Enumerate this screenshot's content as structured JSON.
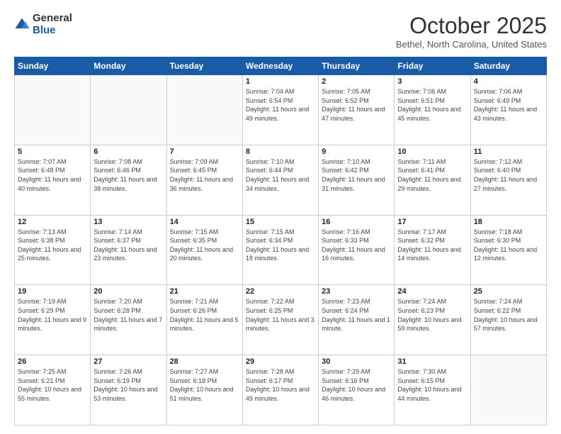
{
  "logo": {
    "general": "General",
    "blue": "Blue"
  },
  "header": {
    "month": "October 2025",
    "location": "Bethel, North Carolina, United States"
  },
  "weekdays": [
    "Sunday",
    "Monday",
    "Tuesday",
    "Wednesday",
    "Thursday",
    "Friday",
    "Saturday"
  ],
  "weeks": [
    [
      {
        "day": "",
        "info": ""
      },
      {
        "day": "",
        "info": ""
      },
      {
        "day": "",
        "info": ""
      },
      {
        "day": "1",
        "info": "Sunrise: 7:04 AM\nSunset: 6:54 PM\nDaylight: 11 hours and 49 minutes."
      },
      {
        "day": "2",
        "info": "Sunrise: 7:05 AM\nSunset: 6:52 PM\nDaylight: 11 hours and 47 minutes."
      },
      {
        "day": "3",
        "info": "Sunrise: 7:06 AM\nSunset: 6:51 PM\nDaylight: 11 hours and 45 minutes."
      },
      {
        "day": "4",
        "info": "Sunrise: 7:06 AM\nSunset: 6:49 PM\nDaylight: 11 hours and 43 minutes."
      }
    ],
    [
      {
        "day": "5",
        "info": "Sunrise: 7:07 AM\nSunset: 6:48 PM\nDaylight: 11 hours and 40 minutes."
      },
      {
        "day": "6",
        "info": "Sunrise: 7:08 AM\nSunset: 6:46 PM\nDaylight: 11 hours and 38 minutes."
      },
      {
        "day": "7",
        "info": "Sunrise: 7:09 AM\nSunset: 6:45 PM\nDaylight: 11 hours and 36 minutes."
      },
      {
        "day": "8",
        "info": "Sunrise: 7:10 AM\nSunset: 6:44 PM\nDaylight: 11 hours and 34 minutes."
      },
      {
        "day": "9",
        "info": "Sunrise: 7:10 AM\nSunset: 6:42 PM\nDaylight: 11 hours and 31 minutes."
      },
      {
        "day": "10",
        "info": "Sunrise: 7:11 AM\nSunset: 6:41 PM\nDaylight: 11 hours and 29 minutes."
      },
      {
        "day": "11",
        "info": "Sunrise: 7:12 AM\nSunset: 6:40 PM\nDaylight: 11 hours and 27 minutes."
      }
    ],
    [
      {
        "day": "12",
        "info": "Sunrise: 7:13 AM\nSunset: 6:38 PM\nDaylight: 11 hours and 25 minutes."
      },
      {
        "day": "13",
        "info": "Sunrise: 7:14 AM\nSunset: 6:37 PM\nDaylight: 11 hours and 23 minutes."
      },
      {
        "day": "14",
        "info": "Sunrise: 7:15 AM\nSunset: 6:35 PM\nDaylight: 11 hours and 20 minutes."
      },
      {
        "day": "15",
        "info": "Sunrise: 7:15 AM\nSunset: 6:34 PM\nDaylight: 11 hours and 18 minutes."
      },
      {
        "day": "16",
        "info": "Sunrise: 7:16 AM\nSunset: 6:33 PM\nDaylight: 11 hours and 16 minutes."
      },
      {
        "day": "17",
        "info": "Sunrise: 7:17 AM\nSunset: 6:32 PM\nDaylight: 11 hours and 14 minutes."
      },
      {
        "day": "18",
        "info": "Sunrise: 7:18 AM\nSunset: 6:30 PM\nDaylight: 11 hours and 12 minutes."
      }
    ],
    [
      {
        "day": "19",
        "info": "Sunrise: 7:19 AM\nSunset: 6:29 PM\nDaylight: 11 hours and 9 minutes."
      },
      {
        "day": "20",
        "info": "Sunrise: 7:20 AM\nSunset: 6:28 PM\nDaylight: 11 hours and 7 minutes."
      },
      {
        "day": "21",
        "info": "Sunrise: 7:21 AM\nSunset: 6:26 PM\nDaylight: 11 hours and 5 minutes."
      },
      {
        "day": "22",
        "info": "Sunrise: 7:22 AM\nSunset: 6:25 PM\nDaylight: 11 hours and 3 minutes."
      },
      {
        "day": "23",
        "info": "Sunrise: 7:23 AM\nSunset: 6:24 PM\nDaylight: 11 hours and 1 minute."
      },
      {
        "day": "24",
        "info": "Sunrise: 7:24 AM\nSunset: 6:23 PM\nDaylight: 10 hours and 59 minutes."
      },
      {
        "day": "25",
        "info": "Sunrise: 7:24 AM\nSunset: 6:22 PM\nDaylight: 10 hours and 57 minutes."
      }
    ],
    [
      {
        "day": "26",
        "info": "Sunrise: 7:25 AM\nSunset: 6:21 PM\nDaylight: 10 hours and 55 minutes."
      },
      {
        "day": "27",
        "info": "Sunrise: 7:26 AM\nSunset: 6:19 PM\nDaylight: 10 hours and 53 minutes."
      },
      {
        "day": "28",
        "info": "Sunrise: 7:27 AM\nSunset: 6:18 PM\nDaylight: 10 hours and 51 minutes."
      },
      {
        "day": "29",
        "info": "Sunrise: 7:28 AM\nSunset: 6:17 PM\nDaylight: 10 hours and 49 minutes."
      },
      {
        "day": "30",
        "info": "Sunrise: 7:29 AM\nSunset: 6:16 PM\nDaylight: 10 hours and 46 minutes."
      },
      {
        "day": "31",
        "info": "Sunrise: 7:30 AM\nSunset: 6:15 PM\nDaylight: 10 hours and 44 minutes."
      },
      {
        "day": "",
        "info": ""
      }
    ]
  ]
}
